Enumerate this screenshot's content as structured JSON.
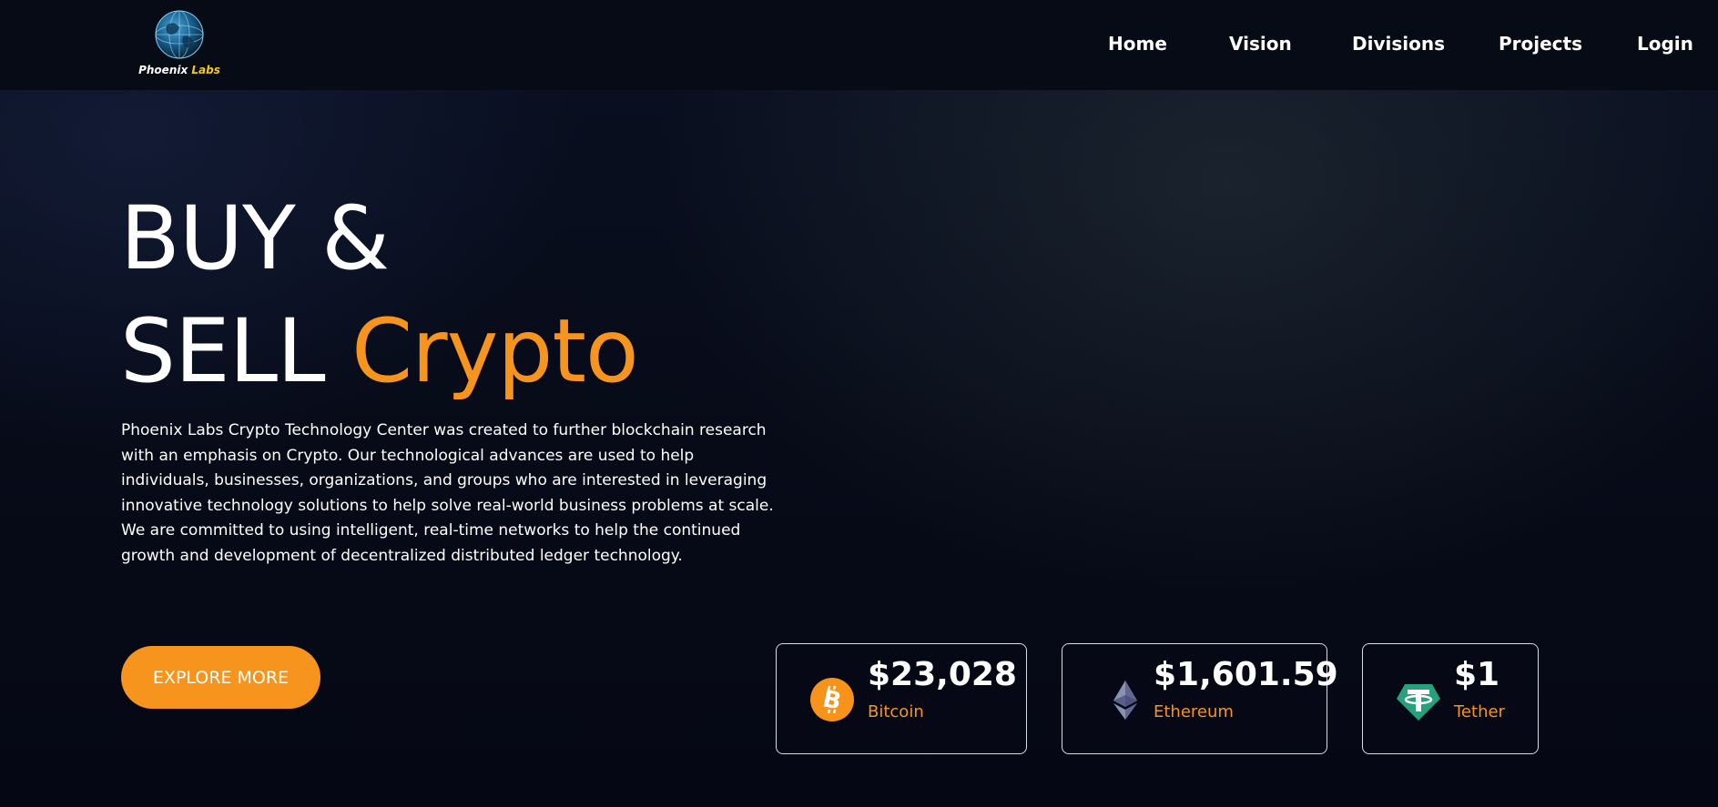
{
  "brand": {
    "name_part1": "Phoenix",
    "name_part2": "Labs",
    "logo_icon": "globe-icon",
    "accent_color": "#f6c915"
  },
  "nav": {
    "items": [
      {
        "label": "Home"
      },
      {
        "label": "Vision"
      },
      {
        "label": "Divisions"
      },
      {
        "label": "Projects"
      },
      {
        "label": "Login"
      }
    ]
  },
  "hero": {
    "title_line1": "BUY &",
    "title_line2_white": "SELL",
    "title_line2_orange": "Crypto",
    "description": "Phoenix Labs Crypto Technology Center was created to further blockchain research with an emphasis on Crypto. Our technological advances are used to help individuals, businesses, organizations, and groups who are interested in leveraging innovative technology solutions to help solve real-world business problems at scale. We are committed to using intelligent, real-time networks to help the continued growth and development of decentralized distributed ledger technology.",
    "cta_label": "EXPLORE MORE",
    "accent_color": "#f7941d"
  },
  "prices": [
    {
      "price": "$23,028",
      "name": "Bitcoin",
      "icon": "bitcoin-icon",
      "icon_color": "#f7931a"
    },
    {
      "price": "$1,601.59",
      "name": "Ethereum",
      "icon": "ethereum-icon",
      "icon_color": "#627eea"
    },
    {
      "price": "$1",
      "name": "Tether",
      "icon": "tether-icon",
      "icon_color": "#26a17b"
    }
  ]
}
